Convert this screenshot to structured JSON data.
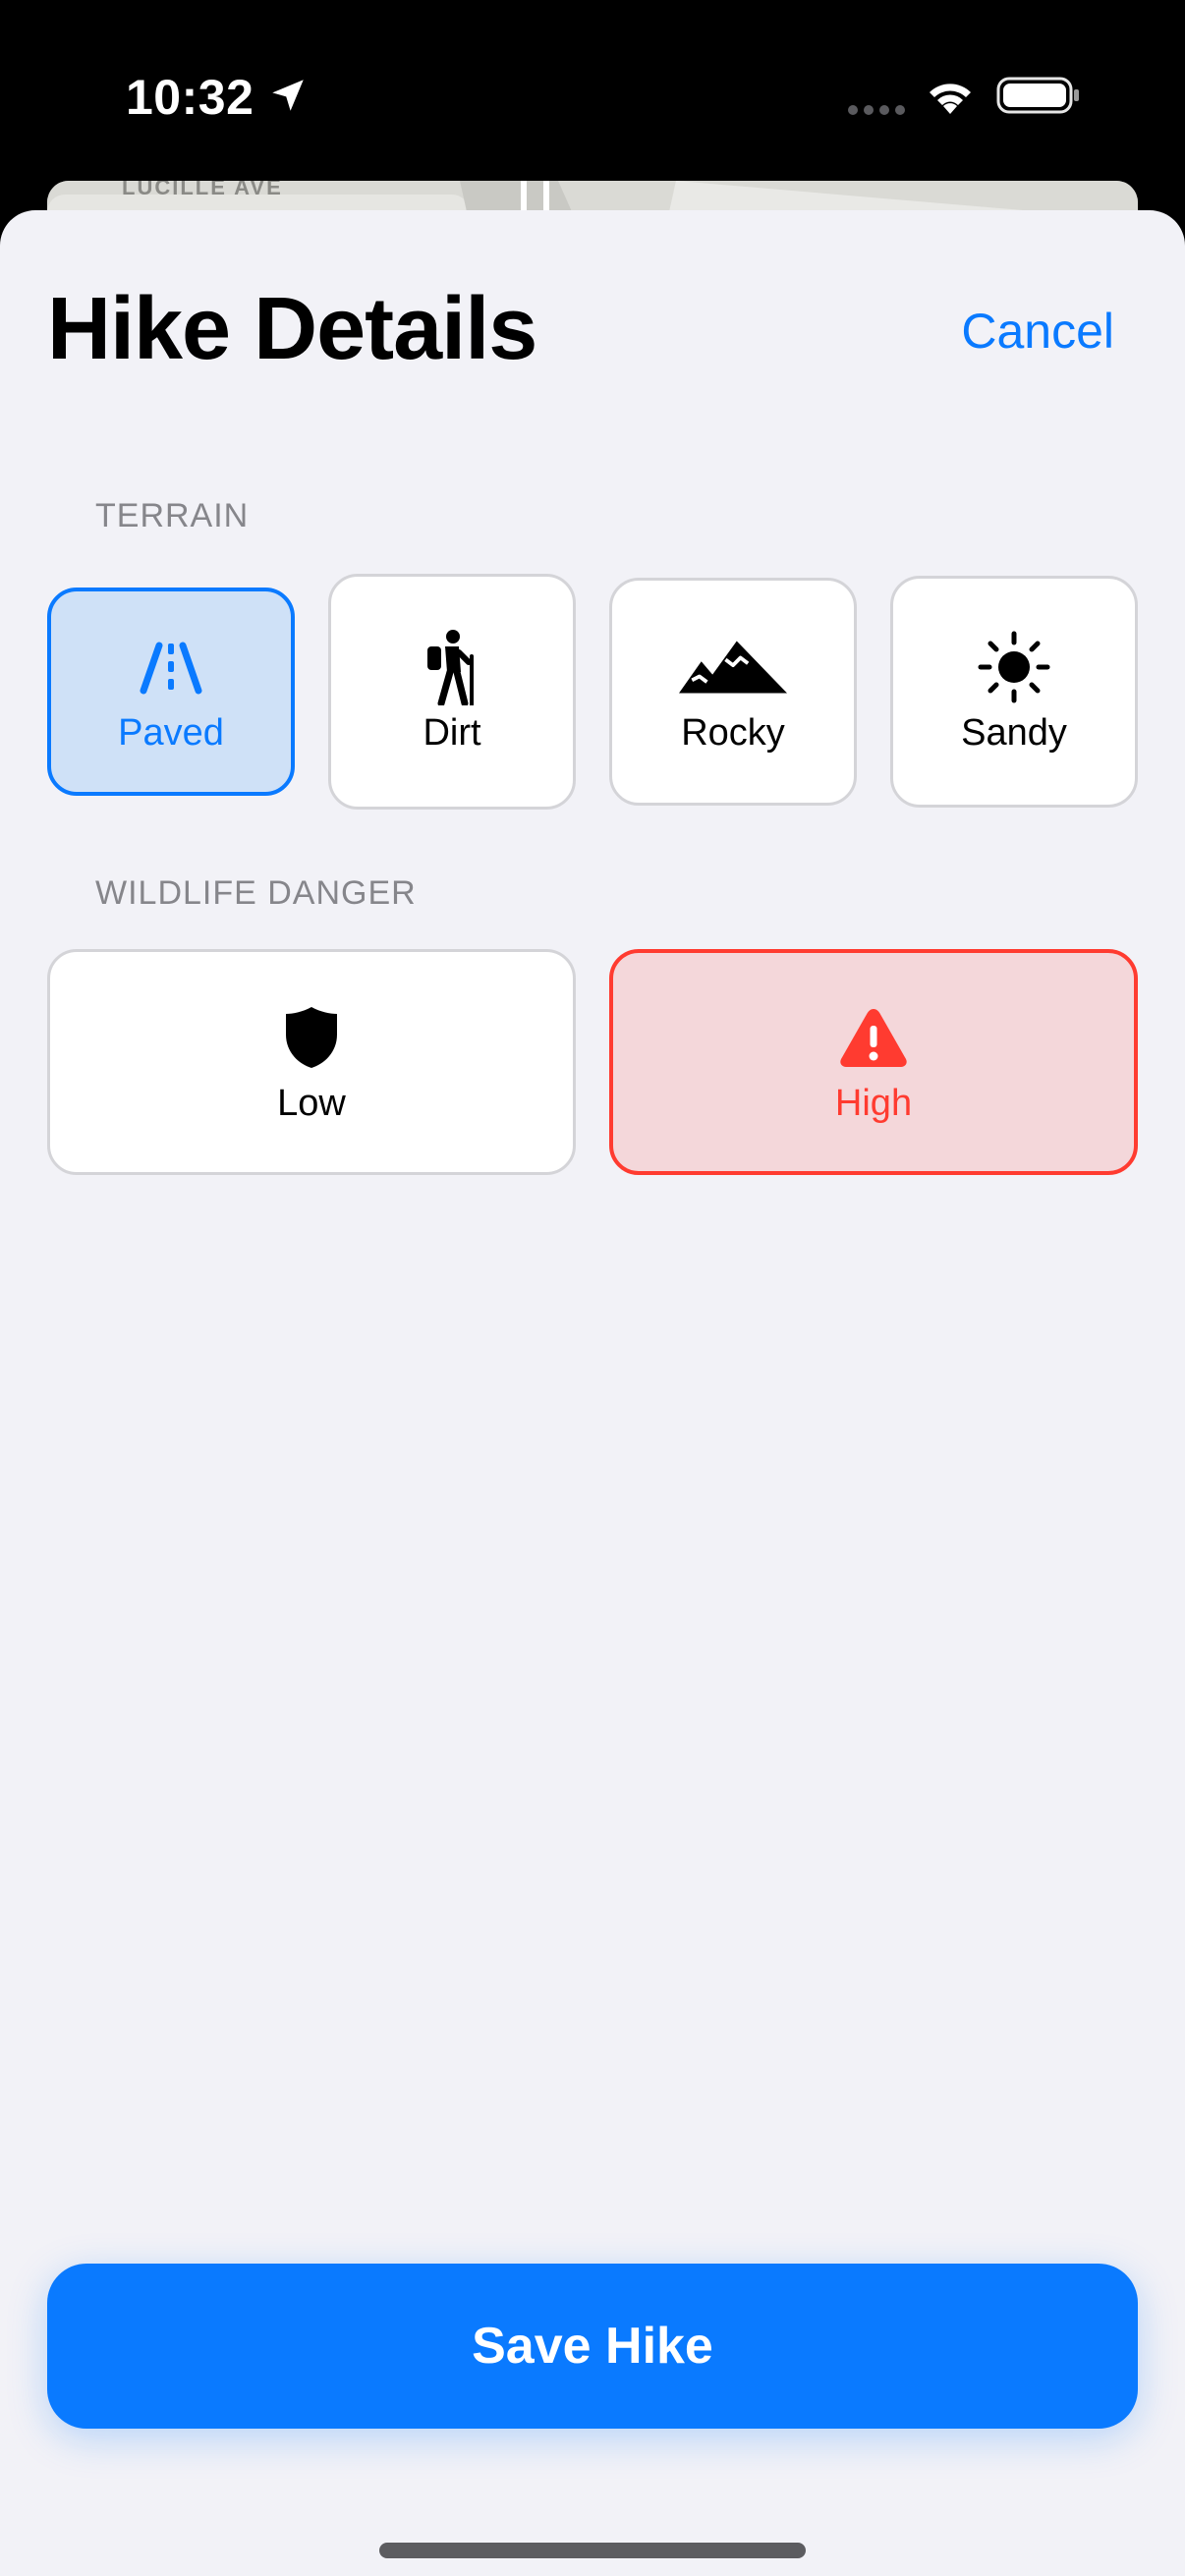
{
  "status_bar": {
    "time": "10:32",
    "icons": [
      "location-arrow-icon",
      "signal-dots-icon",
      "wifi-icon",
      "battery-icon"
    ]
  },
  "header": {
    "title": "Hike Details",
    "cancel_label": "Cancel"
  },
  "background_map": {
    "street_label": "LUCILLE AVE"
  },
  "terrain": {
    "section_label": "TERRAIN",
    "options": [
      {
        "label": "Paved",
        "icon": "road-icon",
        "selected": true
      },
      {
        "label": "Dirt",
        "icon": "hiker-icon",
        "selected": false
      },
      {
        "label": "Rocky",
        "icon": "mountains-icon",
        "selected": false
      },
      {
        "label": "Sandy",
        "icon": "sun-icon",
        "selected": false
      }
    ]
  },
  "wildlife": {
    "section_label": "WILDLIFE DANGER",
    "options": [
      {
        "label": "Low",
        "icon": "shield-icon",
        "selected": false
      },
      {
        "label": "High",
        "icon": "warning-triangle-icon",
        "selected": true
      }
    ]
  },
  "footer": {
    "save_label": "Save Hike"
  },
  "colors": {
    "accent_blue": "#0a7aff",
    "danger_red": "#ff3b30",
    "sheet_background": "#f2f2f7"
  }
}
